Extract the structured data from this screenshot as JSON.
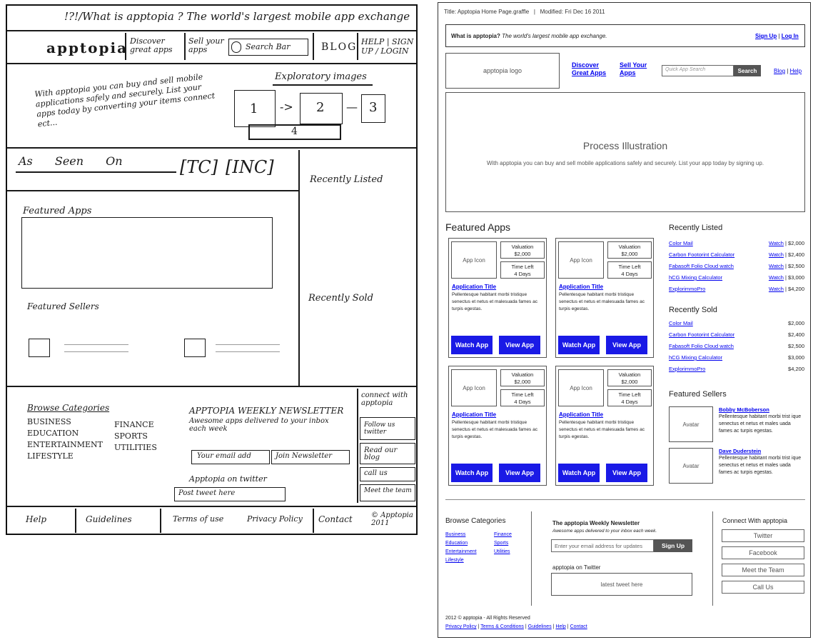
{
  "sketch": {
    "topbar": "!?!/What is apptopia ? The world's largest mobile app exchange",
    "logo": "apptopia",
    "discover": "Discover great apps",
    "sell": "Sell your apps",
    "search": "Search Bar",
    "blog": "BLOG",
    "help_sign": "HELP | SIGN UP / LOGIN",
    "intro": "With apptopia you can buy and sell mobile applications safely and securely. List your apps today by converting your items connect ect...",
    "exploratory": "Exploratory images",
    "steps": [
      "1",
      "2",
      "3",
      "4"
    ],
    "as_seen_on": "As Seen On",
    "tc": "[TC]",
    "inc": "[INC]",
    "recently_listed": "Recently Listed",
    "featured_apps": "Featured Apps",
    "featured_sellers": "Featured Sellers",
    "recently_sold": "Recently Sold",
    "browse": "Browse Categories",
    "categories": [
      "BUSINESS",
      "FINANCE",
      "EDUCATION",
      "SPORTS",
      "ENTERTAINMENT",
      "UTILITIES",
      "LIFESTYLE"
    ],
    "newsletter": "APPTOPIA WEEKLY NEWSLETTER",
    "newsletter_sub": "Awesome apps delivered to your inbox each week",
    "email": "Your email add",
    "join": "Join Newsletter",
    "on_twitter": "Apptopia on twitter",
    "latest_tweet": "Post tweet here",
    "connect": "connect with apptopia",
    "follow": "Follow us twitter",
    "read": "Read our blog",
    "call": "call us",
    "meet": "Meet the team",
    "footer": [
      "Help",
      "Guidelines",
      "Terms of use",
      "Privacy Policy",
      "Contact"
    ],
    "copyright": "© Apptopia 2011"
  },
  "wire": {
    "doc_title": "Title: Apptopia Home Page.graffle   |   Modified: Fri Dec 16 2011",
    "what_is": "What is apptopia?",
    "tagline": "The world's largest mobile app exchange.",
    "signup": "Sign Up",
    "sep": "|",
    "login": "Log In",
    "logo": "apptopia logo",
    "discover": "Discover Great Apps",
    "sell": "Sell Your Apps",
    "search_placeholder": "Quick App Search",
    "search_btn": "Search",
    "blog": "Blog",
    "help": "Help",
    "process_title": "Process Illustration",
    "process_text": "With apptopia you can buy and sell mobile applications safely and securely. List your app today by signing up.",
    "featured_apps": "Featured Apps",
    "app_card": {
      "icon": "App Icon",
      "valuation_label": "Valuation",
      "valuation": "$2,000",
      "time_label": "Time Left",
      "time": "4 Days",
      "title": "Application Title",
      "desc": "Pellentesque habitant morbi tristique senectus et netus et malesuada fames ac turpis egestas.",
      "watch": "Watch App",
      "view": "View App"
    },
    "recently_listed": "Recently Listed",
    "listed": [
      {
        "name": "Color Mail",
        "watch": "Watch",
        "price": "| $2,000"
      },
      {
        "name": "Carbon Footorint Calculator",
        "watch": "Watch",
        "price": "| $2,400"
      },
      {
        "name": "Fabasoft Folio Cloud watch",
        "watch": "Watch",
        "price": "| $2,500"
      },
      {
        "name": "hCG Mixing Calculator",
        "watch": "Watch",
        "price": "| $3,000"
      },
      {
        "name": "ExplorimmoPro",
        "watch": "Watch",
        "price": "| $4,200"
      }
    ],
    "recently_sold": "Recently Sold",
    "sold": [
      {
        "name": "Color Mail",
        "price": "$2,000"
      },
      {
        "name": "Carbon Footorint Calculator",
        "price": "$2,400"
      },
      {
        "name": "Fabasoft Folio Cloud watch",
        "price": "$2,500"
      },
      {
        "name": "hCG Mixing Calculator",
        "price": "$3,000"
      },
      {
        "name": "ExplorimmoPro",
        "price": "$4,200"
      }
    ],
    "featured_sellers": "Featured Sellers",
    "sellers": [
      {
        "avatar": "Avatar",
        "name": "Bobby McBoberson",
        "desc": "Pellentesque habitant morbi trist ique senectus et netus et males uada fames ac turpis egestas."
      },
      {
        "avatar": "Avatar",
        "name": "Dave Duderstein",
        "desc": "Pellentesque habitant morbi trist ique senectus et netus et males uada fames ac turpis egestas."
      }
    ],
    "browse": "Browse Categories",
    "cats_left": [
      "Business",
      "Education",
      "Entertainment",
      "Lifestyle"
    ],
    "cats_right": [
      "Finance",
      "Sports",
      "Utilities"
    ],
    "newsletter_title": "The apptopia Weekly Newsletter",
    "newsletter_sub": "Awesome apps delivered to your inbox each week.",
    "email_placeholder": "Enter your email address for updates",
    "signup_btn": "Sign Up",
    "on_twitter": "apptopia on Twitter",
    "latest_tweet": "latest tweet here",
    "connect_title": "Connect With apptopia",
    "connect": [
      "Twitter",
      "Facebook",
      "Meet the Team",
      "Call Us"
    ],
    "copyright": "2012 © apptopia - All Rights Reserved",
    "footer_links": [
      "Privacy Policy",
      "Terms & Conditions",
      "Guidelines",
      "Help",
      "Contact"
    ],
    "colors": {
      "button_blue": "#1a1ae6",
      "search_grey": "#555555",
      "link_blue": "#0000ee"
    }
  }
}
